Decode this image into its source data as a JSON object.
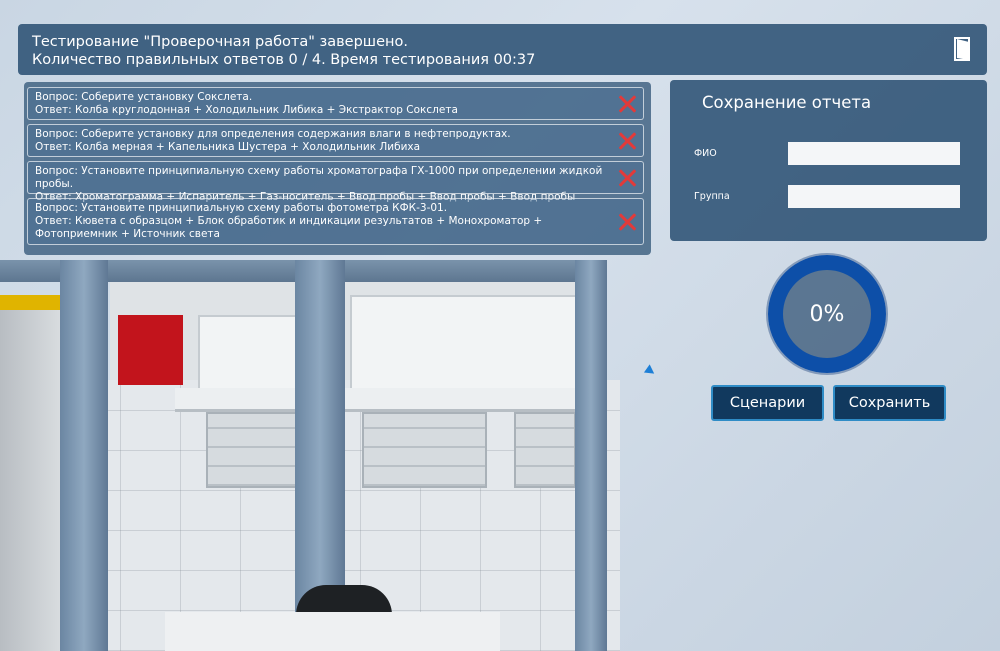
{
  "header": {
    "line1": "Тестирование \"Проверочная работа\" завершено.",
    "line2": "Количество правильных ответов 0 / 4. Время тестирования 00:37",
    "exit_icon": "door-exit-icon"
  },
  "results": [
    {
      "question": "Вопрос: Соберите установку Сокслета.",
      "answer": "Ответ: Колба круглодонная + Холодильник Либика + Экстрактор Сокслета",
      "status": "incorrect"
    },
    {
      "question": "Вопрос: Соберите установку для определения содержания влаги в нефтепродуктах.",
      "answer": "Ответ: Колба мерная + Капельника Шустера + Холодильник Либиха",
      "status": "incorrect"
    },
    {
      "question": "Вопрос: Установите принципиальную схему работы хроматографа ГХ-1000 при определении жидкой пробы.",
      "answer": "Ответ: Хроматограмма + Испаритель + Газ-носитель + Ввод пробы + Ввод пробы + Ввод пробы",
      "status": "incorrect"
    },
    {
      "question": "Вопрос: Установите принципиальную схему работы фотометра КФК-3-01.",
      "answer": "Ответ: Кювета с образцом + Блок обработик и индикации результатов + Монохроматор + Фотоприемник + Источник света",
      "status": "incorrect"
    }
  ],
  "save_report": {
    "title": "Сохранение отчета",
    "fio_label": "ФИО",
    "fio_value": "",
    "group_label": "Группа",
    "group_value": ""
  },
  "progress": {
    "value": 0,
    "label": "0%"
  },
  "buttons": {
    "scenarios": "Сценарии",
    "save": "Сохранить"
  },
  "colors": {
    "panel": "#34587a",
    "cross": "#e23a3a",
    "ring": "#0d4fa8",
    "button_bg": "#11395e",
    "button_border": "#2f8cc6"
  }
}
